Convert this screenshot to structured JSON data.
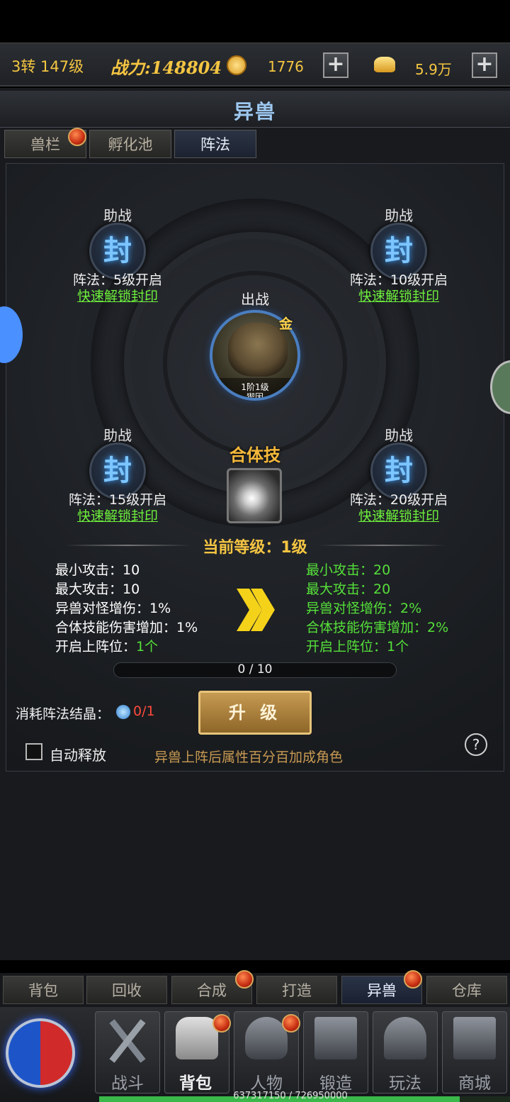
{
  "topbar": {
    "level": "3转 147级",
    "power_label": "战力:",
    "power_value": "148804",
    "currency1": "1776",
    "currency2": "5.9万"
  },
  "panel": {
    "title": "异兽",
    "tabs": [
      "兽栏",
      "孵化池",
      "阵法"
    ],
    "active_tab": "阵法"
  },
  "formation": {
    "assist_label": "助战",
    "seal_char": "封",
    "slots": [
      {
        "req": "阵法：5级开启",
        "link": "快速解锁封印"
      },
      {
        "req": "阵法：10级开启",
        "link": "快速解锁封印"
      },
      {
        "req": "阵法：15级开启",
        "link": "快速解锁封印"
      },
      {
        "req": "阵法：20级开启",
        "link": "快速解锁封印"
      }
    ],
    "main_label": "出战",
    "main_grade": "金",
    "main_stage": "1阶1级",
    "main_name": "猰因",
    "combo_skill": "合体技"
  },
  "level_section": {
    "title": "当前等级：1级",
    "current": [
      "最小攻击：10",
      "最大攻击：10",
      "异兽对怪增伤：1%",
      "合体技能伤害增加：1%"
    ],
    "current_slots_label": "开启上阵位：",
    "current_slots_value": "1个",
    "next": [
      "最小攻击：20",
      "最大攻击：20",
      "异兽对怪增伤：2%",
      "合体技能伤害增加：2%",
      "开启上阵位：1个"
    ],
    "progress_text": "0 / 10",
    "progress_fraction": 0
  },
  "upgrade": {
    "cost_label": "消耗阵法结晶：",
    "cost_value": "0/1",
    "button_label": "升 级",
    "auto_label": "自动释放",
    "hint": "异兽上阵后属性百分百加成角色",
    "help": "?"
  },
  "bottom_tabs": [
    "背包",
    "回收",
    "合成",
    "打造",
    "异兽",
    "仓库"
  ],
  "bottom_active": "异兽",
  "nav": [
    "战斗",
    "背包",
    "人物",
    "锻造",
    "玩法",
    "商城"
  ],
  "exp": {
    "text": "637317150 / 726950000",
    "fraction": 0.877
  },
  "colors": {
    "accent_green": "#55e03a",
    "link_green": "#6ef03c",
    "gold": "#f5c542",
    "title_blue": "#9dc8f0",
    "cost_red": "#ff4a3a"
  }
}
